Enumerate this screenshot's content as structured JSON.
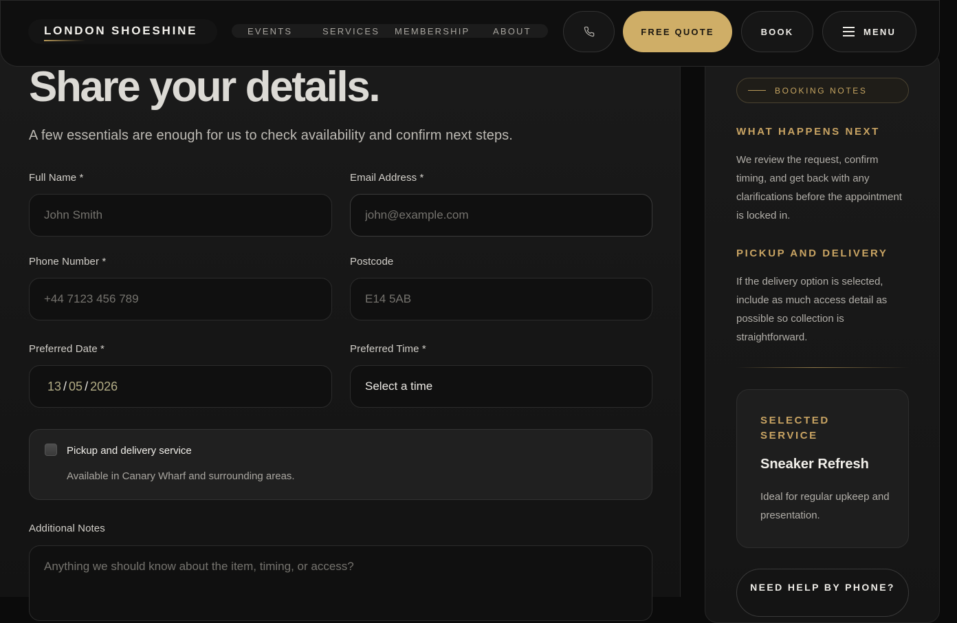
{
  "nav": {
    "brand": "LONDON SHOESHINE",
    "links": [
      "EVENTS",
      "SERVICES",
      "MEMBERSHIP",
      "ABOUT"
    ],
    "phone_icon": "phone-icon",
    "quote_label": "FREE QUOTE",
    "book_label": "BOOK",
    "menu_icon": "hamburger-icon",
    "menu_label": "MENU",
    "accent_color": "#cfae67"
  },
  "form": {
    "title": "Share your details.",
    "subtitle": "A few essentials are enough for us to check availability and confirm next steps.",
    "full_name": {
      "label": "Full Name *",
      "placeholder": "John Smith",
      "value": ""
    },
    "email": {
      "label": "Email Address *",
      "placeholder": "john@example.com",
      "value": ""
    },
    "phone": {
      "label": "Phone Number *",
      "placeholder": "+44 7123 456 789",
      "value": ""
    },
    "postcode": {
      "label": "Postcode",
      "placeholder": "E14 5AB",
      "value": ""
    },
    "date": {
      "label": "Preferred Date *",
      "day": "13",
      "month": "05",
      "year": "2026",
      "separator": "/"
    },
    "time": {
      "label": "Preferred Time *",
      "value": "Select a time"
    },
    "delivery": {
      "checked": false,
      "title": "Pickup and delivery service",
      "description": "Available in Canary Wharf and surrounding areas."
    },
    "notes": {
      "label": "Additional Notes",
      "placeholder": "Anything we should know about the item, timing, or access?"
    }
  },
  "sidebar": {
    "pill": "BOOKING NOTES",
    "next_heading": "WHAT HAPPENS NEXT",
    "next_text": "We review the request, confirm timing, and get back with any clarifications before the appointment is locked in.",
    "delivery_heading": "PICKUP AND DELIVERY",
    "delivery_text": "If the delivery option is selected, include as much access detail as possible so collection is straightforward.",
    "service": {
      "kicker": "SELECTED SERVICE",
      "name": "Sneaker Refresh",
      "description": "Ideal for regular upkeep and presentation."
    },
    "help_label": "NEED HELP BY PHONE?"
  }
}
